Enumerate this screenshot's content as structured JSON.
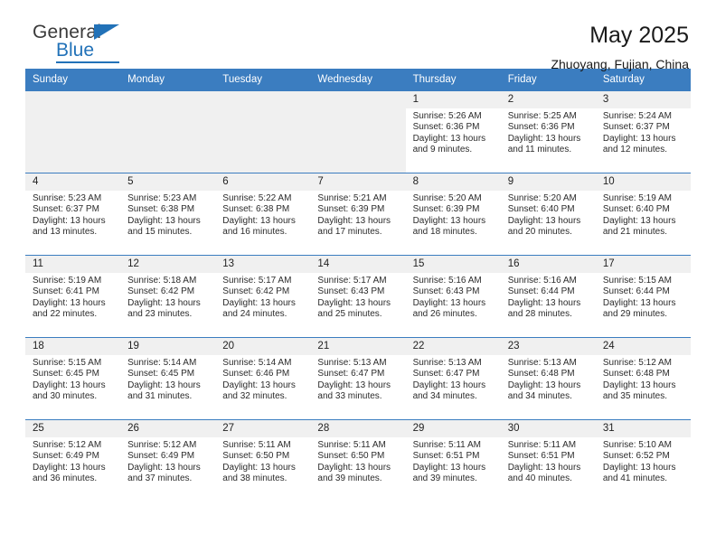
{
  "brand": {
    "word_general": "General",
    "word_blue": "Blue",
    "accent_color": "#2272b8"
  },
  "header": {
    "title": "May 2025",
    "location": "Zhuoyang, Fujian, China"
  },
  "calendar": {
    "header_bg": "#3b7dc0",
    "daynum_bg": "#f0f0f0",
    "weekday_headers": [
      "Sunday",
      "Monday",
      "Tuesday",
      "Wednesday",
      "Thursday",
      "Friday",
      "Saturday"
    ],
    "weeks": [
      [
        {
          "empty": true
        },
        {
          "empty": true
        },
        {
          "empty": true
        },
        {
          "empty": true
        },
        {
          "day": "1",
          "sunrise": "Sunrise: 5:26 AM",
          "sunset": "Sunset: 6:36 PM",
          "daylight": "Daylight: 13 hours and 9 minutes."
        },
        {
          "day": "2",
          "sunrise": "Sunrise: 5:25 AM",
          "sunset": "Sunset: 6:36 PM",
          "daylight": "Daylight: 13 hours and 11 minutes."
        },
        {
          "day": "3",
          "sunrise": "Sunrise: 5:24 AM",
          "sunset": "Sunset: 6:37 PM",
          "daylight": "Daylight: 13 hours and 12 minutes."
        }
      ],
      [
        {
          "day": "4",
          "sunrise": "Sunrise: 5:23 AM",
          "sunset": "Sunset: 6:37 PM",
          "daylight": "Daylight: 13 hours and 13 minutes."
        },
        {
          "day": "5",
          "sunrise": "Sunrise: 5:23 AM",
          "sunset": "Sunset: 6:38 PM",
          "daylight": "Daylight: 13 hours and 15 minutes."
        },
        {
          "day": "6",
          "sunrise": "Sunrise: 5:22 AM",
          "sunset": "Sunset: 6:38 PM",
          "daylight": "Daylight: 13 hours and 16 minutes."
        },
        {
          "day": "7",
          "sunrise": "Sunrise: 5:21 AM",
          "sunset": "Sunset: 6:39 PM",
          "daylight": "Daylight: 13 hours and 17 minutes."
        },
        {
          "day": "8",
          "sunrise": "Sunrise: 5:20 AM",
          "sunset": "Sunset: 6:39 PM",
          "daylight": "Daylight: 13 hours and 18 minutes."
        },
        {
          "day": "9",
          "sunrise": "Sunrise: 5:20 AM",
          "sunset": "Sunset: 6:40 PM",
          "daylight": "Daylight: 13 hours and 20 minutes."
        },
        {
          "day": "10",
          "sunrise": "Sunrise: 5:19 AM",
          "sunset": "Sunset: 6:40 PM",
          "daylight": "Daylight: 13 hours and 21 minutes."
        }
      ],
      [
        {
          "day": "11",
          "sunrise": "Sunrise: 5:19 AM",
          "sunset": "Sunset: 6:41 PM",
          "daylight": "Daylight: 13 hours and 22 minutes."
        },
        {
          "day": "12",
          "sunrise": "Sunrise: 5:18 AM",
          "sunset": "Sunset: 6:42 PM",
          "daylight": "Daylight: 13 hours and 23 minutes."
        },
        {
          "day": "13",
          "sunrise": "Sunrise: 5:17 AM",
          "sunset": "Sunset: 6:42 PM",
          "daylight": "Daylight: 13 hours and 24 minutes."
        },
        {
          "day": "14",
          "sunrise": "Sunrise: 5:17 AM",
          "sunset": "Sunset: 6:43 PM",
          "daylight": "Daylight: 13 hours and 25 minutes."
        },
        {
          "day": "15",
          "sunrise": "Sunrise: 5:16 AM",
          "sunset": "Sunset: 6:43 PM",
          "daylight": "Daylight: 13 hours and 26 minutes."
        },
        {
          "day": "16",
          "sunrise": "Sunrise: 5:16 AM",
          "sunset": "Sunset: 6:44 PM",
          "daylight": "Daylight: 13 hours and 28 minutes."
        },
        {
          "day": "17",
          "sunrise": "Sunrise: 5:15 AM",
          "sunset": "Sunset: 6:44 PM",
          "daylight": "Daylight: 13 hours and 29 minutes."
        }
      ],
      [
        {
          "day": "18",
          "sunrise": "Sunrise: 5:15 AM",
          "sunset": "Sunset: 6:45 PM",
          "daylight": "Daylight: 13 hours and 30 minutes."
        },
        {
          "day": "19",
          "sunrise": "Sunrise: 5:14 AM",
          "sunset": "Sunset: 6:45 PM",
          "daylight": "Daylight: 13 hours and 31 minutes."
        },
        {
          "day": "20",
          "sunrise": "Sunrise: 5:14 AM",
          "sunset": "Sunset: 6:46 PM",
          "daylight": "Daylight: 13 hours and 32 minutes."
        },
        {
          "day": "21",
          "sunrise": "Sunrise: 5:13 AM",
          "sunset": "Sunset: 6:47 PM",
          "daylight": "Daylight: 13 hours and 33 minutes."
        },
        {
          "day": "22",
          "sunrise": "Sunrise: 5:13 AM",
          "sunset": "Sunset: 6:47 PM",
          "daylight": "Daylight: 13 hours and 34 minutes."
        },
        {
          "day": "23",
          "sunrise": "Sunrise: 5:13 AM",
          "sunset": "Sunset: 6:48 PM",
          "daylight": "Daylight: 13 hours and 34 minutes."
        },
        {
          "day": "24",
          "sunrise": "Sunrise: 5:12 AM",
          "sunset": "Sunset: 6:48 PM",
          "daylight": "Daylight: 13 hours and 35 minutes."
        }
      ],
      [
        {
          "day": "25",
          "sunrise": "Sunrise: 5:12 AM",
          "sunset": "Sunset: 6:49 PM",
          "daylight": "Daylight: 13 hours and 36 minutes."
        },
        {
          "day": "26",
          "sunrise": "Sunrise: 5:12 AM",
          "sunset": "Sunset: 6:49 PM",
          "daylight": "Daylight: 13 hours and 37 minutes."
        },
        {
          "day": "27",
          "sunrise": "Sunrise: 5:11 AM",
          "sunset": "Sunset: 6:50 PM",
          "daylight": "Daylight: 13 hours and 38 minutes."
        },
        {
          "day": "28",
          "sunrise": "Sunrise: 5:11 AM",
          "sunset": "Sunset: 6:50 PM",
          "daylight": "Daylight: 13 hours and 39 minutes."
        },
        {
          "day": "29",
          "sunrise": "Sunrise: 5:11 AM",
          "sunset": "Sunset: 6:51 PM",
          "daylight": "Daylight: 13 hours and 39 minutes."
        },
        {
          "day": "30",
          "sunrise": "Sunrise: 5:11 AM",
          "sunset": "Sunset: 6:51 PM",
          "daylight": "Daylight: 13 hours and 40 minutes."
        },
        {
          "day": "31",
          "sunrise": "Sunrise: 5:10 AM",
          "sunset": "Sunset: 6:52 PM",
          "daylight": "Daylight: 13 hours and 41 minutes."
        }
      ]
    ]
  }
}
